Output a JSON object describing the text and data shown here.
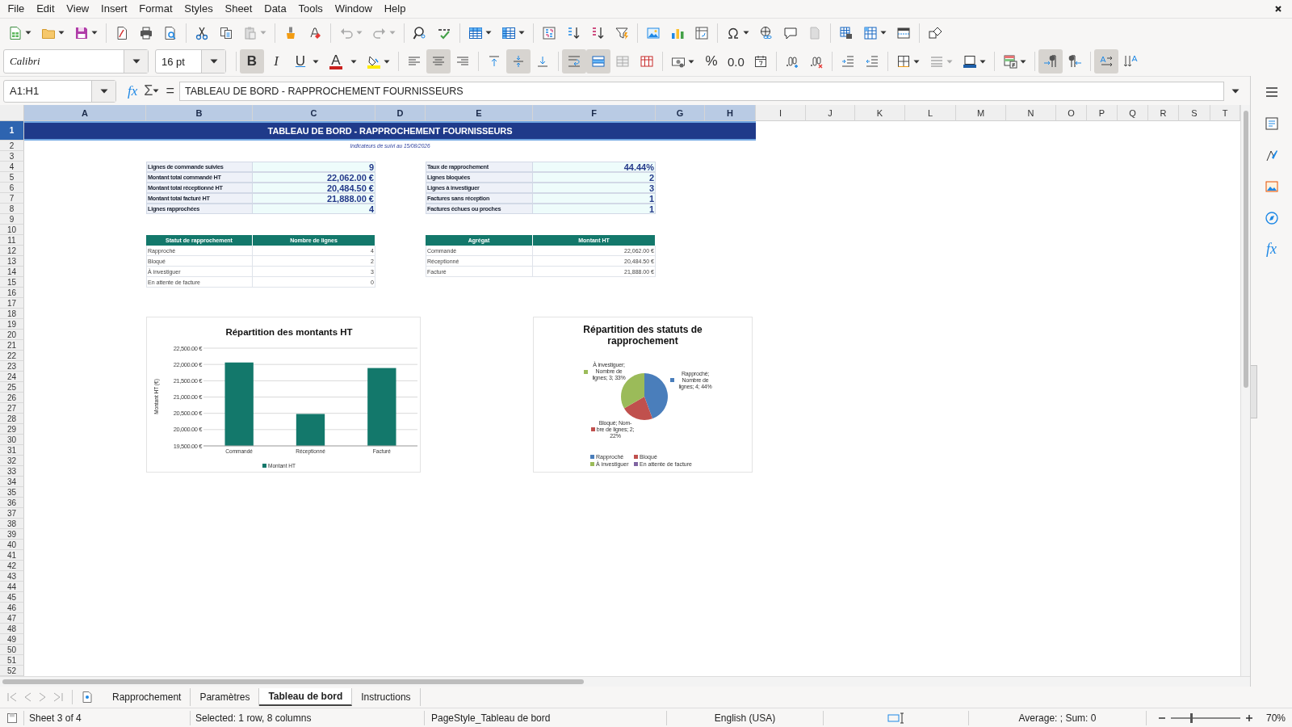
{
  "menu": [
    "File",
    "Edit",
    "View",
    "Insert",
    "Format",
    "Styles",
    "Sheet",
    "Data",
    "Tools",
    "Window",
    "Help"
  ],
  "formatting": {
    "font_name": "Calibri",
    "font_size": "16 pt",
    "bold": {
      "label": "B",
      "selected": true
    },
    "italic": {
      "label": "I",
      "selected": false
    },
    "underline": {
      "label": "U",
      "selected": false
    },
    "font_color": {
      "label": "A"
    },
    "align_left": false,
    "align_center": true,
    "align_right": false,
    "align_top": false,
    "align_middle": true,
    "align_bottom": false,
    "wrap_text": true,
    "merge_center": true,
    "percent": "%",
    "number": "0.0",
    "left_to_right": true,
    "right_to_left": false,
    "text_horizontal": true,
    "text_vertical": false
  },
  "formula_bar": {
    "name_box": "A1:H1",
    "function_wizard": "fx",
    "sum": "Σ",
    "equals": "=",
    "content": "TABLEAU DE BORD - RAPPROCHEMENT FOURNISSEURS"
  },
  "sheet": {
    "columns": [
      {
        "label": "A",
        "selected": true
      },
      {
        "label": "B",
        "selected": true
      },
      {
        "label": "C",
        "selected": true
      },
      {
        "label": "D",
        "selected": true
      },
      {
        "label": "E",
        "selected": true
      },
      {
        "label": "F",
        "selected": true
      },
      {
        "label": "G",
        "selected": true
      },
      {
        "label": "H",
        "selected": true
      },
      {
        "label": "I",
        "selected": false
      },
      {
        "label": "J",
        "selected": false
      },
      {
        "label": "K",
        "selected": false
      },
      {
        "label": "L",
        "selected": false
      },
      {
        "label": "M",
        "selected": false
      },
      {
        "label": "N",
        "selected": false
      },
      {
        "label": "O",
        "selected": false
      },
      {
        "label": "P",
        "selected": false
      },
      {
        "label": "Q",
        "selected": false
      },
      {
        "label": "R",
        "selected": false
      },
      {
        "label": "S",
        "selected": false
      },
      {
        "label": "T",
        "selected": false
      }
    ],
    "rows": [
      {
        "label": "1",
        "selected": true
      },
      {
        "label": "2",
        "selected": false
      },
      {
        "label": "3",
        "selected": false
      },
      {
        "label": "4",
        "selected": false
      },
      {
        "label": "5",
        "selected": false
      },
      {
        "label": "6",
        "selected": false
      },
      {
        "label": "7",
        "selected": false
      },
      {
        "label": "8",
        "selected": false
      },
      {
        "label": "9",
        "selected": false
      },
      {
        "label": "10",
        "selected": false
      },
      {
        "label": "11",
        "selected": false
      },
      {
        "label": "12",
        "selected": false
      },
      {
        "label": "13",
        "selected": false
      },
      {
        "label": "14",
        "selected": false
      },
      {
        "label": "15",
        "selected": false
      },
      {
        "label": "16",
        "selected": false
      },
      {
        "label": "17",
        "selected": false
      },
      {
        "label": "18",
        "selected": false
      },
      {
        "label": "19",
        "selected": false
      },
      {
        "label": "20",
        "selected": false
      },
      {
        "label": "21",
        "selected": false
      },
      {
        "label": "22",
        "selected": false
      },
      {
        "label": "23",
        "selected": false
      },
      {
        "label": "24",
        "selected": false
      },
      {
        "label": "25",
        "selected": false
      },
      {
        "label": "26",
        "selected": false
      },
      {
        "label": "27",
        "selected": false
      },
      {
        "label": "28",
        "selected": false
      },
      {
        "label": "29",
        "selected": false
      },
      {
        "label": "30",
        "selected": false
      },
      {
        "label": "31",
        "selected": false
      },
      {
        "label": "32",
        "selected": false
      },
      {
        "label": "33",
        "selected": false
      },
      {
        "label": "34",
        "selected": false
      },
      {
        "label": "35",
        "selected": false
      },
      {
        "label": "36",
        "selected": false
      },
      {
        "label": "37",
        "selected": false
      },
      {
        "label": "38",
        "selected": false
      },
      {
        "label": "39",
        "selected": false
      },
      {
        "label": "40",
        "selected": false
      },
      {
        "label": "41",
        "selected": false
      },
      {
        "label": "42",
        "selected": false
      },
      {
        "label": "43",
        "selected": false
      },
      {
        "label": "44",
        "selected": false
      },
      {
        "label": "45",
        "selected": false
      },
      {
        "label": "46",
        "selected": false
      },
      {
        "label": "47",
        "selected": false
      },
      {
        "label": "48",
        "selected": false
      },
      {
        "label": "49",
        "selected": false
      },
      {
        "label": "50",
        "selected": false
      },
      {
        "label": "51",
        "selected": false
      },
      {
        "label": "52",
        "selected": false
      }
    ],
    "title": "TABLEAU DE BORD - RAPPROCHEMENT FOURNISSEURS",
    "subtitle": "Indicateurs de suivi au 15/08/2026",
    "kpis_left": [
      {
        "label": "Lignes de commande suivies",
        "value": "9"
      },
      {
        "label": "Montant total commandé HT",
        "value": "22,062.00 €"
      },
      {
        "label": "Montant total réceptionné HT",
        "value": "20,484.50 €"
      },
      {
        "label": "Montant total facturé HT",
        "value": "21,888.00 €"
      },
      {
        "label": "Lignes rapprochées",
        "value": "4"
      }
    ],
    "kpis_right": [
      {
        "label": "Taux de rapprochement",
        "value": "44.44%"
      },
      {
        "label": "Lignes bloquées",
        "value": "2"
      },
      {
        "label": "Lignes à investiguer",
        "value": "3"
      },
      {
        "label": "Factures sans réception",
        "value": "1"
      },
      {
        "label": "Factures échues ou proches",
        "value": "1"
      }
    ],
    "status_table": {
      "columns": [
        "Statut de rapprochement",
        "Nombre de lignes"
      ],
      "rows": [
        [
          "Rapproché",
          "4"
        ],
        [
          "Bloqué",
          "2"
        ],
        [
          "À investiguer",
          "3"
        ],
        [
          "En attente de facture",
          "0"
        ]
      ]
    },
    "aggregate_table": {
      "columns": [
        "Agrégat",
        "Montant HT"
      ],
      "rows": [
        [
          "Commandé",
          "22,062.00 €"
        ],
        [
          "Réceptionné",
          "20,484.50 €"
        ],
        [
          "Facturé",
          "21,888.00 €"
        ]
      ]
    },
    "charts": [
      {
        "chart_data": {
          "type": "bar",
          "title": "Répartition des montants HT",
          "ylabel": "Montant HT (€)",
          "categories": [
            "Commandé",
            "Réceptionné",
            "Facturé"
          ],
          "ylim": [
            19500,
            22500
          ],
          "grid": true,
          "legend": true,
          "series": [
            {
              "name": "Montant HT",
              "color": "#13786b",
              "values": [
                22060,
                20480,
                21890
              ]
            }
          ],
          "yticks": [
            {
              "value": 19500,
              "label": "19,500.00 €"
            },
            {
              "value": 20000,
              "label": "20,000.00 €"
            },
            {
              "value": 20500,
              "label": "20,500.00 €"
            },
            {
              "value": 21000,
              "label": "21,000.00 €"
            },
            {
              "value": 21500,
              "label": "21,500.00 €"
            },
            {
              "value": 22000,
              "label": "22,000.00 €"
            },
            {
              "value": 22500,
              "label": "22,500.00 €"
            }
          ]
        }
      },
      {
        "chart_data": {
          "type": "pie",
          "title": "Répartition des statuts de rapprochement",
          "categories": [
            "Rapproché",
            "Bloqué",
            "À investiguer",
            "En attente de facture"
          ],
          "legend": true,
          "series": [
            {
              "values": [
                44.4,
                22.2,
                33.4,
                0
              ]
            }
          ],
          "colors": [
            "#4a7ebb",
            "#c0504d",
            "#9bbb59",
            "#8064a2"
          ],
          "value_labels": [
            "Rapproché; Nombre de lignes; 4; 44%",
            "Bloqué; Nom-bre de lignes; 2; 22%",
            "À investiguer; Nombre de lignes; 3; 33%",
            null
          ]
        }
      }
    ]
  },
  "sidebar": {
    "functions": "fx"
  },
  "sheet_tabs": [
    {
      "label": "Rapprochement",
      "selected": false
    },
    {
      "label": "Paramètres",
      "selected": false
    },
    {
      "label": "Tableau de bord",
      "selected": true
    },
    {
      "label": "Instructions",
      "selected": false
    }
  ],
  "status_bar": {
    "sheet": "Sheet 3 of 4",
    "selection": "Selected: 1 row, 8 columns",
    "page_style": "PageStyle_Tableau de bord",
    "language": "English (USA)",
    "summary": "Average: ; Sum: 0",
    "zoom_slider": {
      "level": 0.3
    },
    "zoom": "70%"
  }
}
